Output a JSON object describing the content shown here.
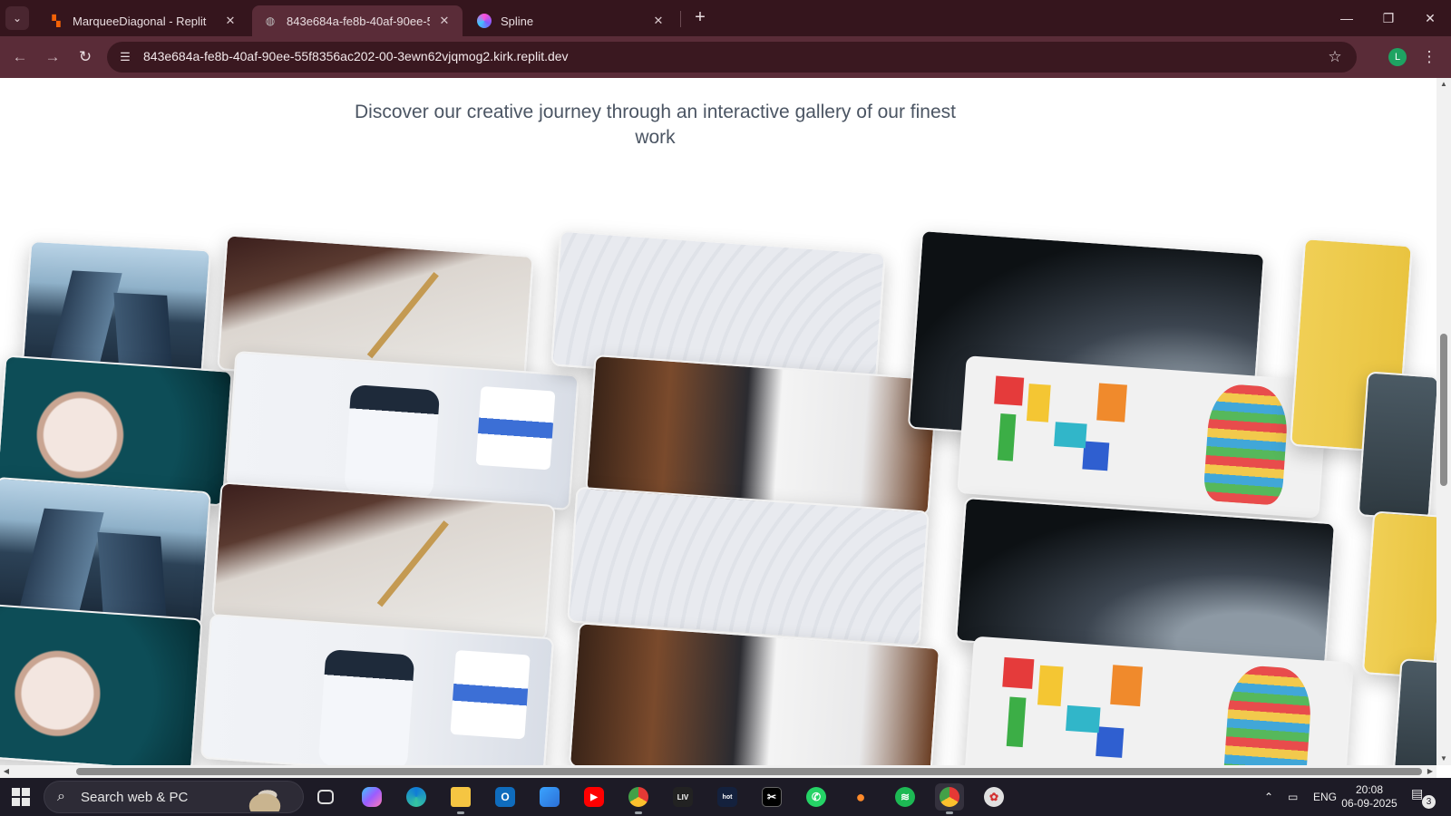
{
  "browser": {
    "tabs": [
      {
        "title": "MarqueeDiagonal - Replit",
        "active": false,
        "favicon": "replit-icon",
        "color": "#f26207"
      },
      {
        "title": "843e684a-fe8b-40af-90ee-55f8",
        "active": true,
        "favicon": "globe-icon",
        "color": "#bfbfbf"
      },
      {
        "title": "Spline",
        "active": false,
        "favicon": "spline-icon",
        "color": "#7b5cff"
      }
    ],
    "new_tab_symbol": "+",
    "url": "843e684a-fe8b-40af-90ee-55f8356ac202-00-3ewn62vjqmog2.kirk.replit.dev",
    "profile_initial": "L",
    "colors": {
      "frame": "#35151d",
      "toolbar": "#5a2c38",
      "omnibox": "#3a1820"
    }
  },
  "page": {
    "subtitle": "Discover our creative journey through an interactive gallery of our finest work",
    "gallery_images": [
      "office buildings",
      "wristwatch",
      "sketching hand",
      "abstract white waves",
      "sports car",
      "weather app on phone",
      "developer at desk",
      "colorful toys"
    ]
  },
  "taskbar": {
    "search_placeholder": "Search web & PC",
    "apps": [
      "task-view",
      "copilot",
      "edge",
      "file-explorer",
      "outlook",
      "store",
      "youtube",
      "chrome-profile-a",
      "sony-liv",
      "hotstar",
      "capcut",
      "whatsapp",
      "voice-recorder",
      "spotify",
      "chrome-profile-l",
      "app-red"
    ],
    "language": "ENG",
    "time": "20:08",
    "date": "06-09-2025",
    "notification_count": "3"
  }
}
